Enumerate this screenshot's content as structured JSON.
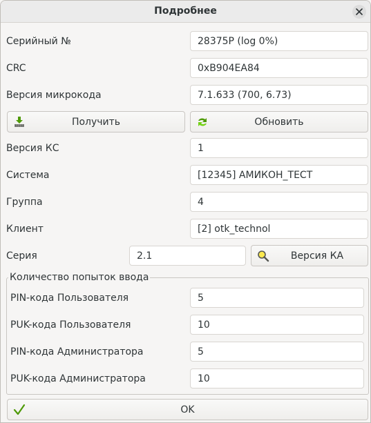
{
  "window": {
    "title": "Подробнее"
  },
  "rows": {
    "serial": {
      "label": "Серийный №",
      "value": "28375P (log 0%)"
    },
    "crc": {
      "label": "CRC",
      "value": "0xB904EA84"
    },
    "firmware": {
      "label": "Версия микрокода",
      "value": "7.1.633 (700, 6.73)"
    },
    "ks": {
      "label": "Версия КС",
      "value": "1"
    },
    "system": {
      "label": "Система",
      "value": "[12345] АМИКОН_ТЕСТ"
    },
    "group": {
      "label": "Группа",
      "value": "4"
    },
    "client": {
      "label": "Клиент",
      "value": "[2] otk_technol"
    },
    "series": {
      "label": "Серия",
      "value": "2.1"
    }
  },
  "buttons": {
    "get": "Получить",
    "update": "Обновить",
    "ka_version": "Версия КА",
    "ok": "OK"
  },
  "attempts": {
    "title": "Количество попыток ввода",
    "rows": [
      {
        "label": "PIN-кода Пользователя",
        "value": "5"
      },
      {
        "label": "PUK-кода Пользователя",
        "value": "10"
      },
      {
        "label": "PIN-кода Администратора",
        "value": "5"
      },
      {
        "label": "PUK-кода Администратора",
        "value": "10"
      }
    ]
  },
  "icons": {
    "get": "download-basket-icon",
    "update": "refresh-arrows-icon",
    "ka_version": "magnifier-icon",
    "ok": "checkmark-icon",
    "close": "close-icon"
  }
}
